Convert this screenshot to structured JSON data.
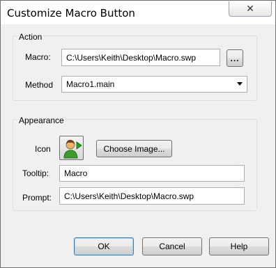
{
  "window": {
    "title": "Customize Macro Button",
    "close_label": "✕"
  },
  "action": {
    "group_title": "Action",
    "macro_label": "Macro:",
    "macro_value": "C:\\Users\\Keith\\Desktop\\Macro.swp",
    "browse_label": "...",
    "method_label": "Method",
    "method_value": "Macro1.main"
  },
  "appearance": {
    "group_title": "Appearance",
    "icon_label": "Icon",
    "icon_name": "user-run-icon",
    "choose_image_label": "Choose Image...",
    "tooltip_label": "Tooltip:",
    "tooltip_value": "Macro",
    "prompt_label": "Prompt:",
    "prompt_value": "C:\\Users\\Keith\\Desktop\\Macro.swp"
  },
  "buttons": {
    "ok": "OK",
    "cancel": "Cancel",
    "help": "Help"
  },
  "colors": {
    "window_bg": "#f0f0f0",
    "group_border": "#d5dfe5",
    "default_button_border": "#3c7fb1"
  }
}
